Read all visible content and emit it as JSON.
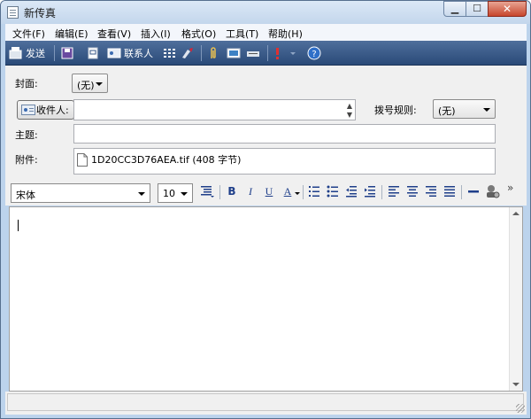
{
  "window": {
    "title": "新传真"
  },
  "menu": [
    "文件(F)",
    "编辑(E)",
    "查看(V)",
    "插入(I)",
    "格式(O)",
    "工具(T)",
    "帮助(H)"
  ],
  "toolbar": {
    "send_label": "发送",
    "contacts_label": "联系人"
  },
  "form": {
    "cover_label": "封面:",
    "cover_value": "(无)",
    "recipient_button": "收件人:",
    "recipient_value": "",
    "dial_rule_label": "拨号规则:",
    "dial_rule_value": "(无)",
    "subject_label": "主题:",
    "subject_value": "",
    "attachment_label": "附件:",
    "attachment_file": "1D20CC3D76AEA.tif (408 字节)"
  },
  "format": {
    "font": "宋体",
    "size": "10",
    "bold": "B",
    "italic": "I",
    "underline": "U",
    "font_color": "A",
    "overflow": "»"
  },
  "editor": {
    "body": ""
  },
  "colors": {
    "toolbar": "#2a4a78",
    "titlebar": "#c3d6ec",
    "close": "#c7462c"
  }
}
